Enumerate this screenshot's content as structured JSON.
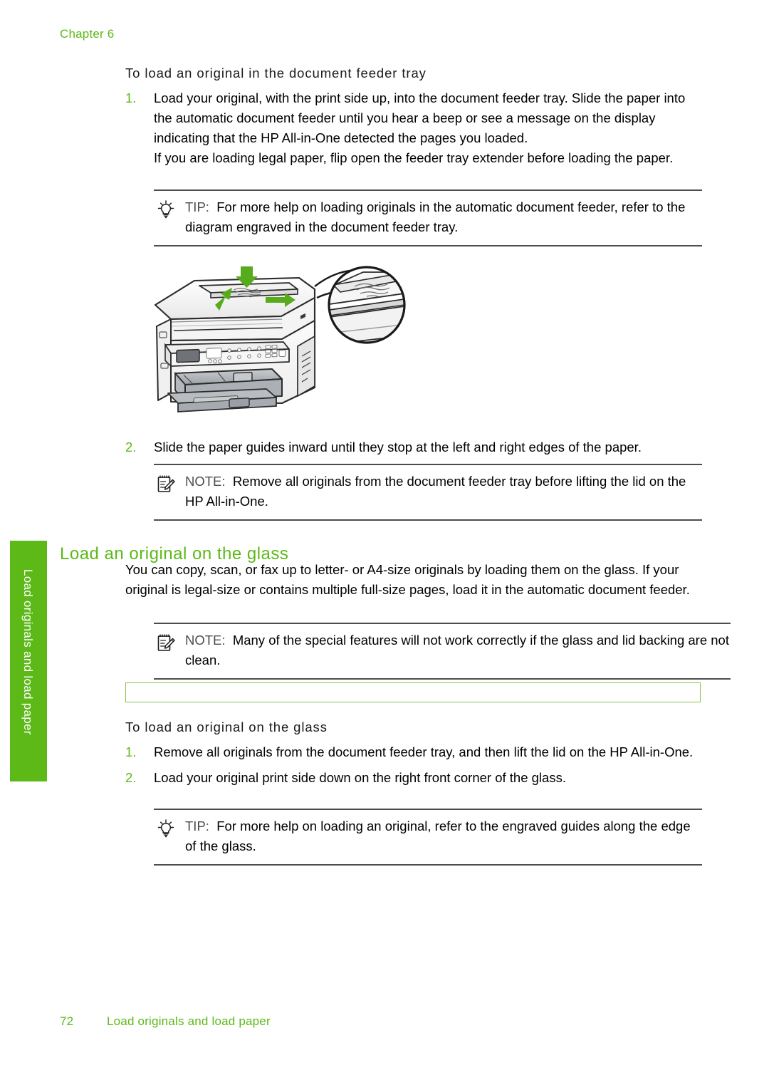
{
  "page": {
    "chapter_label": "Chapter 6",
    "footer_page_number": "72",
    "footer_title": "Load originals and load paper",
    "side_tab_label": "Load originals and load paper",
    "accent_green": "#5cb917",
    "box_border_green": "#8bc34a",
    "rule_color": "#4d4d4d"
  },
  "procedure_feeder": {
    "title": "To load an original in the document feeder tray",
    "steps": [
      {
        "num": "1.",
        "paragraphs": [
          "Load your original, with the print side up, into the document feeder tray. Slide the paper into the automatic document feeder until you hear a beep or see a message on the display indicating that the HP All-in-One detected the pages you loaded.",
          "If you are loading legal paper, flip open the feeder tray extender before loading the paper."
        ]
      },
      {
        "num": "2.",
        "paragraphs": [
          "Slide the paper guides inward until they stop at the left and right edges of the paper."
        ]
      }
    ],
    "tip": {
      "icon": "lightbulb-icon",
      "label": "TIP:",
      "text": "For more help on loading originals in the automatic document feeder, refer to the diagram engraved in the document feeder tray."
    },
    "note": {
      "icon": "notepad-pencil-icon",
      "label": "NOTE:",
      "text": "Remove all originals from the document feeder tray before lifting the lid on the HP All-in-One."
    },
    "figure": {
      "name": "hp-all-in-one-printer-illustration",
      "description": "Line drawing of an HP All-in-One printer with green arrows indicating loading direction and a magnified circular callout of the document feeder tray"
    }
  },
  "section_glass": {
    "heading": "Load an original on the glass",
    "intro": "You can copy, scan, or fax up to letter- or A4-size originals by loading them on the glass. If your original is legal-size or contains multiple full-size pages, load it in the automatic document feeder.",
    "note": {
      "icon": "notepad-pencil-icon",
      "label": "NOTE:",
      "text": "Many of the special features will not work correctly if the glass and lid backing are not clean."
    },
    "empty_box": {
      "name": "empty-callout-box",
      "content": ""
    },
    "procedure": {
      "title": "To load an original on the glass",
      "steps": [
        {
          "num": "1.",
          "paragraphs": [
            "Remove all originals from the document feeder tray, and then lift the lid on the HP All-in-One."
          ]
        },
        {
          "num": "2.",
          "paragraphs": [
            "Load your original print side down on the right front corner of the glass."
          ]
        }
      ],
      "tip": {
        "icon": "lightbulb-icon",
        "label": "TIP:",
        "text": "For more help on loading an original, refer to the engraved guides along the edge of the glass."
      }
    }
  }
}
